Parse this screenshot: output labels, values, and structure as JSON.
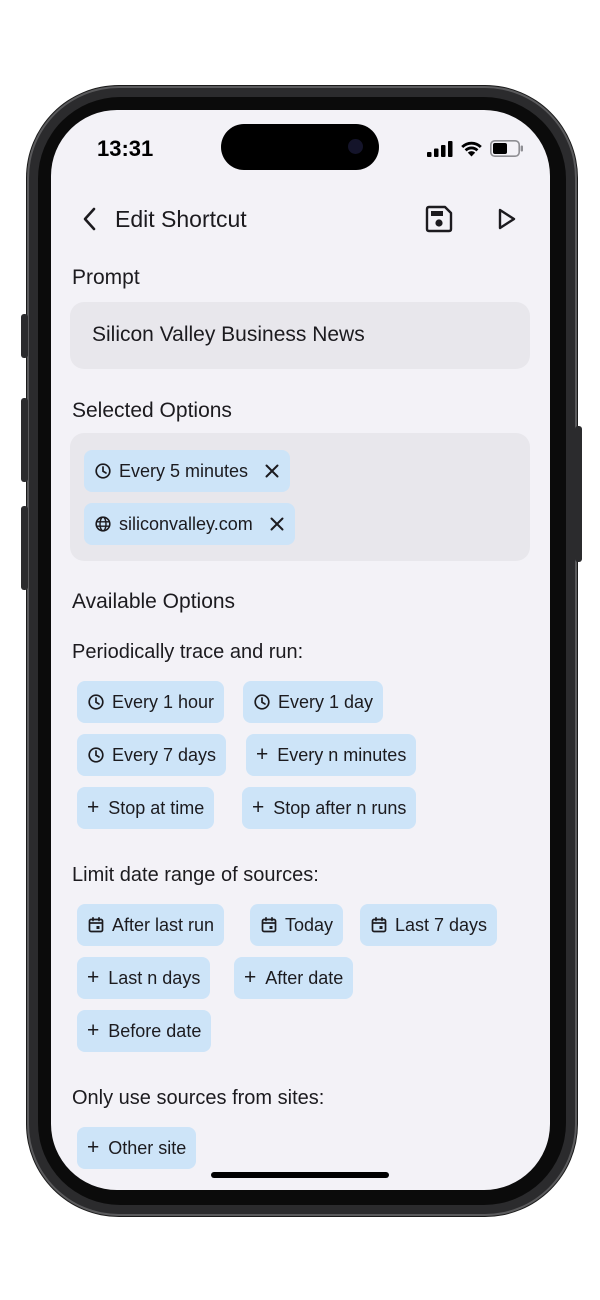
{
  "status": {
    "time": "13:31"
  },
  "header": {
    "title": "Edit Shortcut"
  },
  "prompt": {
    "label": "Prompt",
    "value": "Silicon Valley Business News"
  },
  "selected": {
    "label": "Selected Options",
    "chips": [
      "Every 5 minutes",
      "siliconvalley.com"
    ]
  },
  "available": {
    "label": "Available Options",
    "periodic": {
      "label": "Periodically trace and run:",
      "chips": [
        "Every 1 hour",
        "Every 1 day",
        "Every 7 days",
        "Every n minutes",
        "Stop at time",
        "Stop after n runs"
      ]
    },
    "date_range": {
      "label": "Limit date range of sources:",
      "chips": [
        "After last run",
        "Today",
        "Last 7 days",
        "Last n days",
        "After date",
        "Before date"
      ]
    },
    "sites": {
      "label": "Only use sources from sites:",
      "chips": [
        "Other site"
      ]
    }
  },
  "icons": {
    "clock": "clock-icon",
    "globe": "globe-icon",
    "calendar": "calendar-icon",
    "plus": "plus-icon",
    "close": "close-icon",
    "back": "chevron-left-icon",
    "save": "save-icon",
    "run": "play-icon"
  },
  "colors": {
    "chip_bg": "#cde4f8",
    "screen_bg": "#f3f2f7",
    "field_bg": "#e8e7ec"
  }
}
